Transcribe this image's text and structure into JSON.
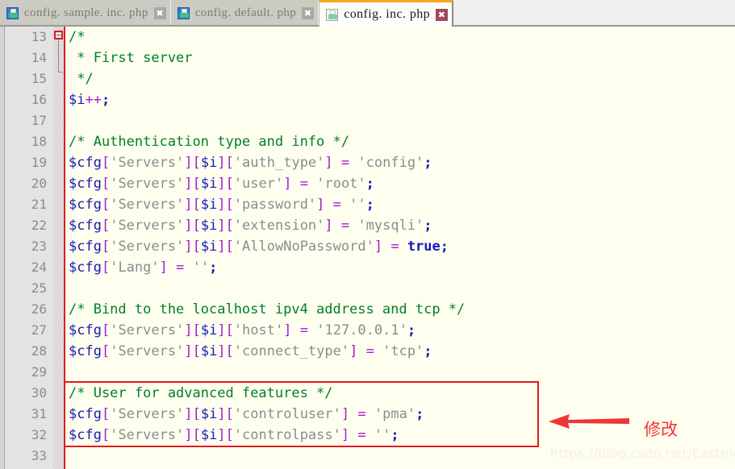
{
  "tabbar": {
    "tabs": [
      {
        "title": "config. sample. inc. php",
        "icon": "floppy-disk-icon",
        "close_glyph": "✖",
        "active": false
      },
      {
        "title": "config. default. php",
        "icon": "floppy-disk-icon",
        "close_glyph": "✖",
        "active": false
      },
      {
        "title": "config. inc. php",
        "icon": "floppy-disk-icon",
        "close_glyph": "✖",
        "active": true
      }
    ]
  },
  "editor": {
    "language": "php",
    "first_visible_line": 13,
    "last_visible_line": 33,
    "line_numbers": [
      "13",
      "14",
      "15",
      "16",
      "17",
      "18",
      "19",
      "20",
      "21",
      "22",
      "23",
      "24",
      "25",
      "26",
      "27",
      "28",
      "29",
      "30",
      "31",
      "32",
      "33"
    ],
    "fold_marker_line": 13,
    "fold_end_line": 15,
    "lines": [
      {
        "n": "13",
        "text": "/*"
      },
      {
        "n": "14",
        "text": " * First server"
      },
      {
        "n": "15",
        "text": " */"
      },
      {
        "n": "16",
        "text": "$i++;"
      },
      {
        "n": "17",
        "text": ""
      },
      {
        "n": "18",
        "text": "/* Authentication type and info */"
      },
      {
        "n": "19",
        "text": "$cfg['Servers'][$i]['auth_type'] = 'config';"
      },
      {
        "n": "20",
        "text": "$cfg['Servers'][$i]['user'] = 'root';"
      },
      {
        "n": "21",
        "text": "$cfg['Servers'][$i]['password'] = '';"
      },
      {
        "n": "22",
        "text": "$cfg['Servers'][$i]['extension'] = 'mysqli';"
      },
      {
        "n": "23",
        "text": "$cfg['Servers'][$i]['AllowNoPassword'] = true;"
      },
      {
        "n": "24",
        "text": "$cfg['Lang'] = '';"
      },
      {
        "n": "25",
        "text": ""
      },
      {
        "n": "26",
        "text": "/* Bind to the localhost ipv4 address and tcp */"
      },
      {
        "n": "27",
        "text": "$cfg['Servers'][$i]['host'] = '127.0.0.1';"
      },
      {
        "n": "28",
        "text": "$cfg['Servers'][$i]['connect_type'] = 'tcp';"
      },
      {
        "n": "29",
        "text": ""
      },
      {
        "n": "30",
        "text": "/* User for advanced features */"
      },
      {
        "n": "31",
        "text": "$cfg['Servers'][$i]['controluser'] = 'pma';"
      },
      {
        "n": "32",
        "text": "$cfg['Servers'][$i]['controlpass'] = '';"
      },
      {
        "n": "33",
        "text": ""
      }
    ],
    "highlight": {
      "from_line": "30",
      "to_line": "32",
      "color": "#e01b1b"
    }
  },
  "annotation": {
    "arrow_name": "left-arrow-icon",
    "arrow_color": "#f03535",
    "label": "修改",
    "label_color": "#f03535"
  },
  "watermark": {
    "text": "https://blog.csdn.net/Eastmount"
  },
  "colors": {
    "comment": "#007f27",
    "variable": "#1a1ab4",
    "bracket": "#a21ad6",
    "string": "#8c8c8c",
    "operator": "#a21ad6",
    "keyword": "#1616c8",
    "code_background": "#fffff0",
    "gutter_background": "#e3e3e3",
    "active_tab_accent": "#f5a623"
  }
}
